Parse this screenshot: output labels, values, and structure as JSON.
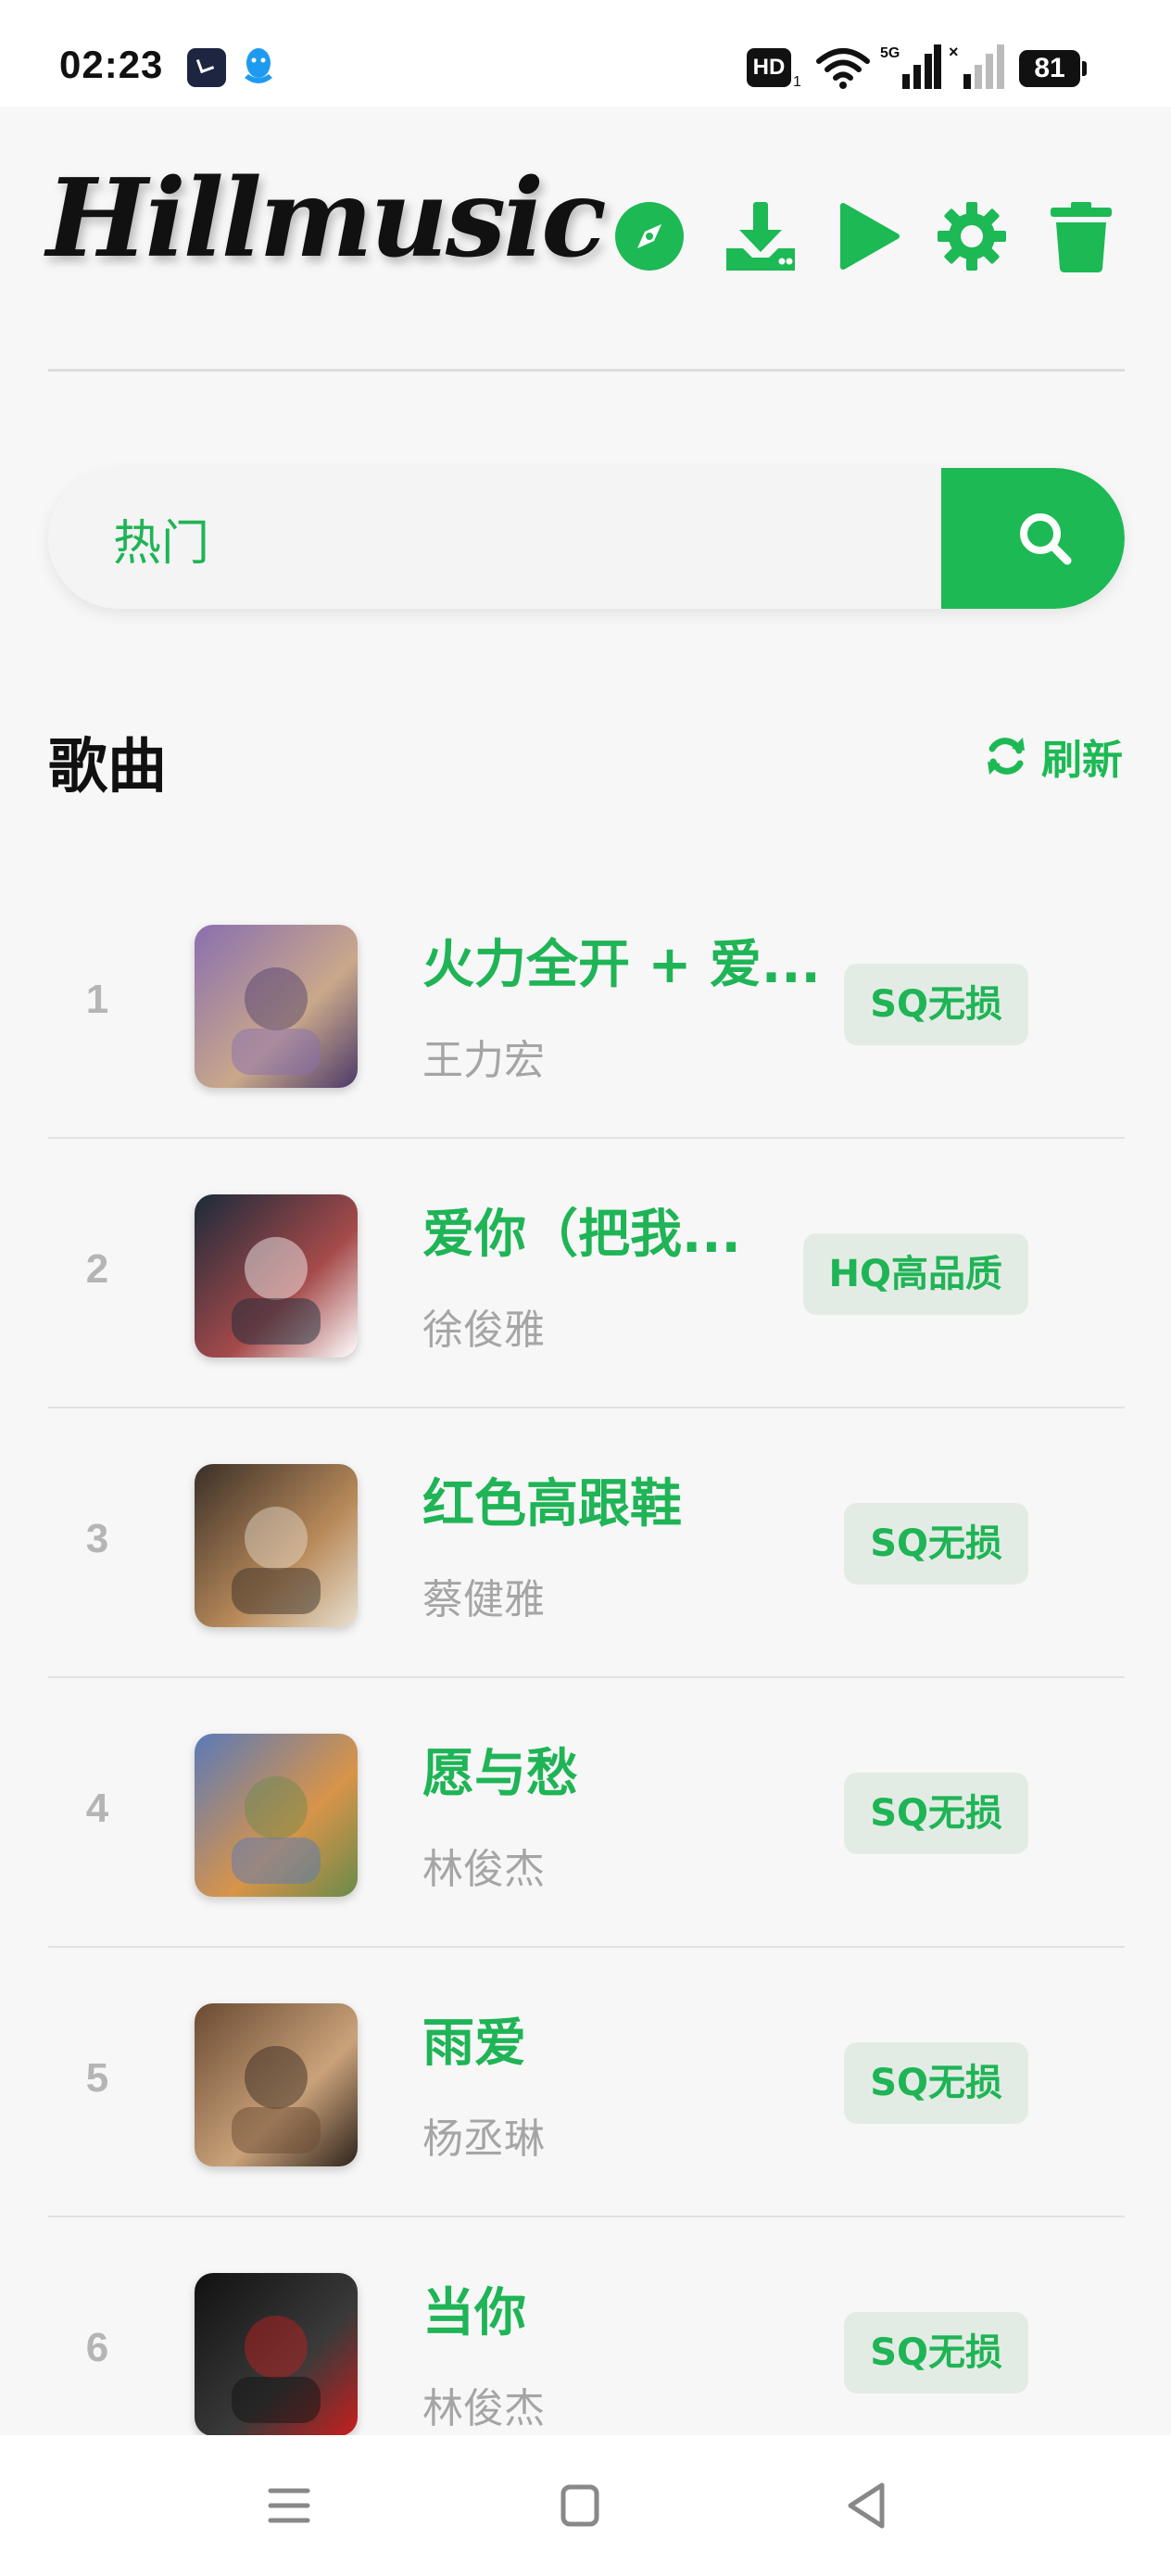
{
  "status_bar": {
    "time": "02:23",
    "hd_label": "HD",
    "hd_sub": "1",
    "signal_label": "5G",
    "battery": "81"
  },
  "header": {
    "logo": "Hillmusic",
    "accent_color": "#1db954",
    "actions": [
      "compass-icon",
      "download-icon",
      "play-icon",
      "settings-icon",
      "trash-icon"
    ]
  },
  "search": {
    "value": "热门",
    "button_icon": "search-icon"
  },
  "section": {
    "title": "歌曲",
    "refresh_label": "刷新"
  },
  "songs": [
    {
      "rank": "1",
      "title": "火力全开 + 爱...",
      "artist": "王力宏",
      "quality": "SQ无损",
      "cover_colors": [
        "#8a6fb0",
        "#c9a88a",
        "#4c3a6a"
      ]
    },
    {
      "rank": "2",
      "title": "爱你（把我...",
      "artist": "徐俊雅",
      "quality": "HQ高品质",
      "cover_colors": [
        "#1c2a3a",
        "#a54a4a",
        "#ffffff"
      ]
    },
    {
      "rank": "3",
      "title": "红色高跟鞋",
      "artist": "蔡健雅",
      "quality": "SQ无损",
      "cover_colors": [
        "#3a2f28",
        "#b88a5a",
        "#e8e0d0"
      ]
    },
    {
      "rank": "4",
      "title": "愿与愁",
      "artist": "林俊杰",
      "quality": "SQ无损",
      "cover_colors": [
        "#5a7ab8",
        "#d8944a",
        "#6a8a4a"
      ]
    },
    {
      "rank": "5",
      "title": "雨爱",
      "artist": "杨丞琳",
      "quality": "SQ无损",
      "cover_colors": [
        "#6a4a32",
        "#caa27a",
        "#2e241c"
      ]
    },
    {
      "rank": "6",
      "title": "当你",
      "artist": "林俊杰",
      "quality": "SQ无损",
      "cover_colors": [
        "#111111",
        "#3a3a3a",
        "#c81e1e"
      ]
    }
  ],
  "nav": [
    "menu-icon",
    "home-icon",
    "back-icon"
  ]
}
